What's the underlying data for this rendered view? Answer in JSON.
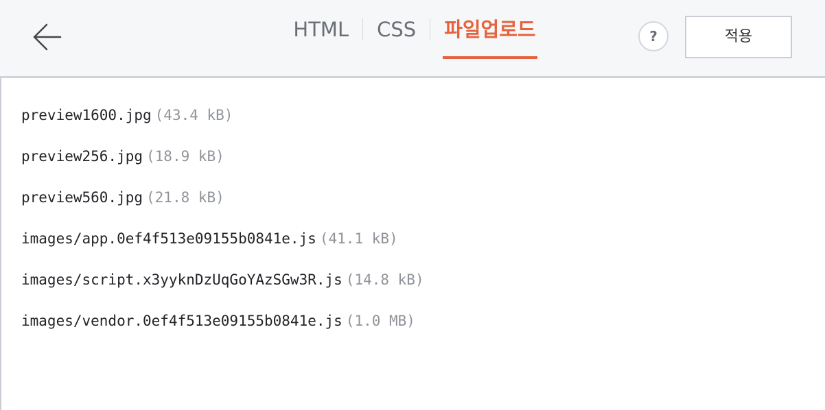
{
  "header": {
    "tabs": [
      {
        "label": "HTML",
        "active": false
      },
      {
        "label": "CSS",
        "active": false
      },
      {
        "label": "파일업로드",
        "active": true
      }
    ],
    "help_label": "?",
    "apply_label": "적용"
  },
  "files": [
    {
      "name": "preview1600.jpg",
      "size": "(43.4 kB)"
    },
    {
      "name": "preview256.jpg",
      "size": "(18.9 kB)"
    },
    {
      "name": "preview560.jpg",
      "size": "(21.8 kB)"
    },
    {
      "name": "images/app.0ef4f513e09155b0841e.js",
      "size": "(41.1 kB)"
    },
    {
      "name": "images/script.x3yyknDzUqGoYAzSGw3R.js",
      "size": "(14.8 kB)"
    },
    {
      "name": "images/vendor.0ef4f513e09155b0841e.js",
      "size": "(1.0 MB)"
    }
  ],
  "colors": {
    "accent": "#e4633d",
    "header_background": "#f6f7f9",
    "tab_text": "#6b6f75",
    "file_size_text": "#8f9399"
  },
  "icons": {
    "back": "arrow-left-icon",
    "help": "question-circle-icon"
  }
}
